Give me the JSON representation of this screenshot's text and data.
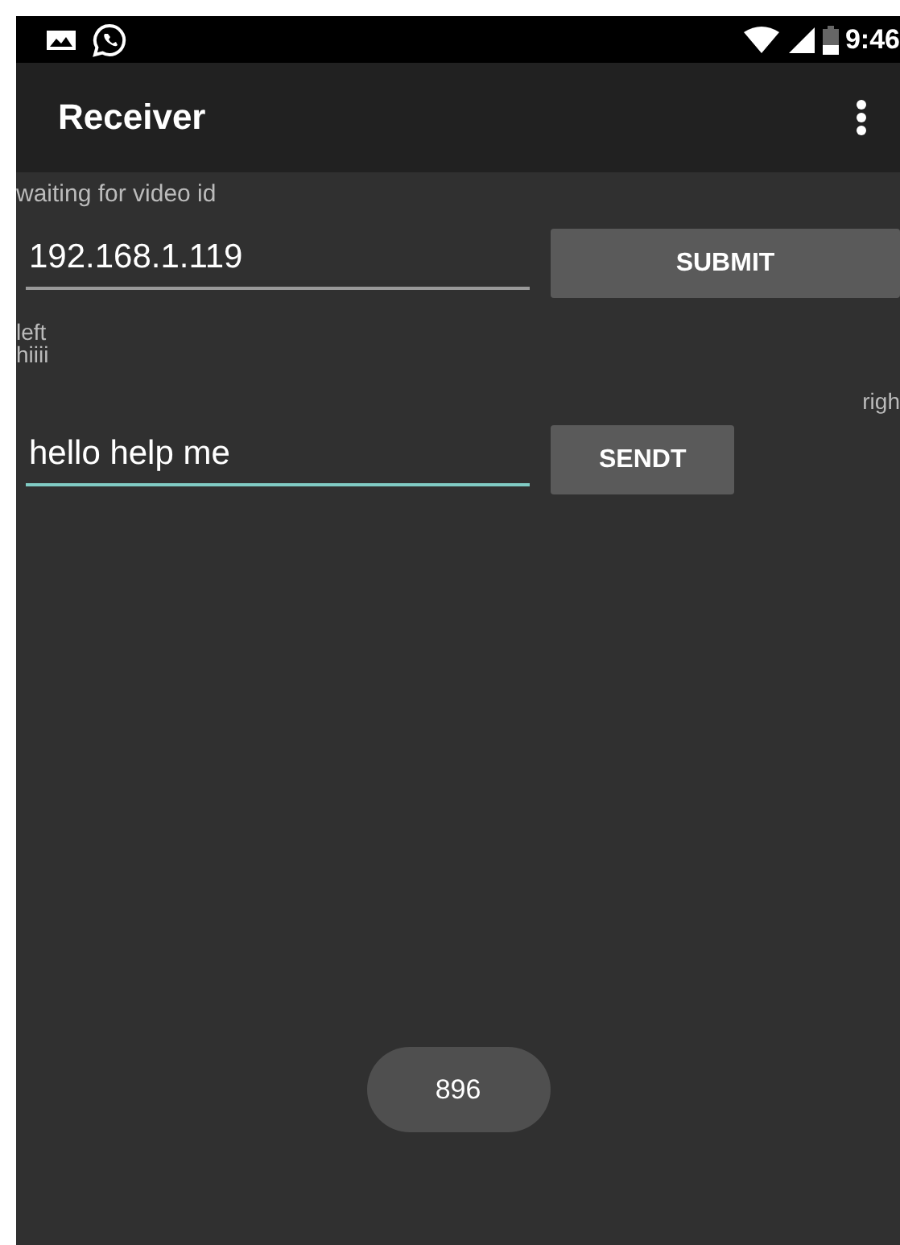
{
  "status_bar": {
    "time": "9:46"
  },
  "app_bar": {
    "title": "Receiver"
  },
  "status_label": "waiting for video id",
  "ip_row": {
    "field": {
      "value": "192.168.1.119",
      "focused": false
    },
    "button": "SUBMIT"
  },
  "messages": [
    {
      "text": "left",
      "kind": "incoming"
    },
    {
      "text": "hiiii",
      "kind": "incoming"
    },
    {
      "text": "righ",
      "kind": "outgoing"
    }
  ],
  "message_row": {
    "field": {
      "value": "hello help me",
      "focused": true
    },
    "button": "SENDT"
  },
  "toast": "896"
}
